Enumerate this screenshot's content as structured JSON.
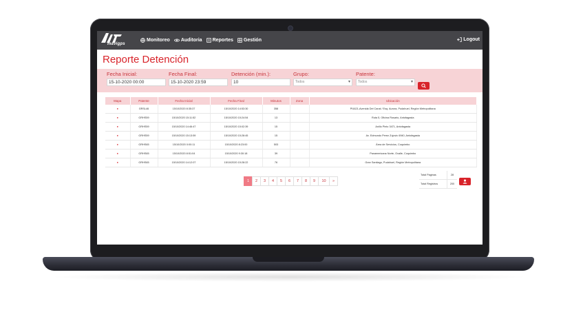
{
  "brand": {
    "name": "mavigps",
    "accent": "#d8232a",
    "navbar_bg": "#454549",
    "filter_bg": "#f7d3d6"
  },
  "nav": {
    "items": [
      {
        "label": "Monitoreo",
        "icon": "globe-icon"
      },
      {
        "label": "Auditoria",
        "icon": "eye-icon"
      },
      {
        "label": "Reportes",
        "icon": "report-icon"
      },
      {
        "label": "Gestión",
        "icon": "grid-icon"
      }
    ],
    "logout": "Logout"
  },
  "page": {
    "title": "Reporte Detención"
  },
  "filters": {
    "fecha_inicial": {
      "label": "Fecha Inicial:",
      "value": "15-10-2020 00:00"
    },
    "fecha_final": {
      "label": "Fecha Final:",
      "value": "15-10-2020 23:59"
    },
    "detencion": {
      "label": "Detención (min.):",
      "value": "10"
    },
    "grupo": {
      "label": "Grupo:",
      "value": "Todos"
    },
    "patente": {
      "label": "Patente:",
      "value": "Todos"
    }
  },
  "table": {
    "headers": [
      "Mapa",
      "Patente",
      "Fecha Inicial",
      "Fecha Final",
      "Minutos",
      "Zona",
      "Ubicación"
    ],
    "rows": [
      [
        "GRSL46",
        "15/10/2020 8:35:37",
        "15/10/2020 14:53:30",
        "358",
        "",
        "Pt1621-Avenida Del Canal / Esq. Aurora, Pudahuel, Región Metropolitana"
      ],
      [
        "GRHS59",
        "15/10/2020 15:11:52",
        "15/10/2020 15:24:54",
        "13",
        "",
        "Ruta 5, Oficina Rosario, Antofagasta"
      ],
      [
        "GRHS59",
        "15/10/2020 14:46:47",
        "15/10/2020 15:02:39",
        "15",
        "",
        "Anillo Pinto 3471, Antofagasta"
      ],
      [
        "GRHS59",
        "15/10/2020 15:13:59",
        "15/10/2020 15:28:45",
        "15",
        "",
        "Av. Edmundo Perez Zujovic 6940, Antofagasta"
      ],
      [
        "GRHS65",
        "15/10/2020 0:00:11",
        "15/10/2020 8:23:00",
        "503",
        "",
        "Área de Servicios, Coquimbo"
      ],
      [
        "GRHS65",
        "15/10/2020 8:51:04",
        "15/10/2020 9:30:18",
        "39",
        "",
        "Panamericana Norte, Ovalle, Coquimbo"
      ],
      [
        "GRHS65",
        "15/10/2020 14:12:07",
        "15/10/2020 15:28:22",
        "76",
        "",
        "Gran Santiago, Pudahuel, Región Metropolitana"
      ]
    ]
  },
  "pagination": {
    "pages": [
      "1",
      "2",
      "3",
      "4",
      "5",
      "6",
      "7",
      "8",
      "9",
      "10",
      "»"
    ],
    "active": "1"
  },
  "totals": {
    "paginas_label": "Total Paginas",
    "paginas_value": "28",
    "registros_label": "Total Registros",
    "registros_value": "200"
  }
}
